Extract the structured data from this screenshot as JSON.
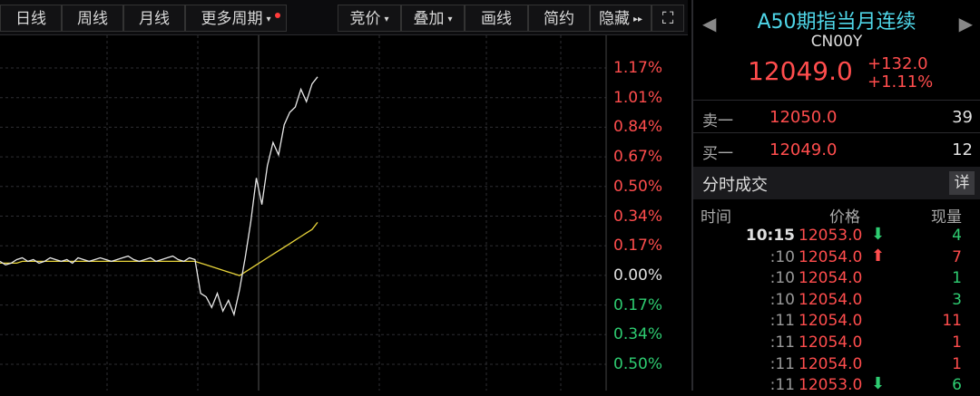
{
  "toolbar": {
    "items": [
      {
        "label": "日线",
        "arrow": ""
      },
      {
        "label": "周线",
        "arrow": ""
      },
      {
        "label": "月线",
        "arrow": ""
      },
      {
        "label": "更多周期",
        "arrow": "▾"
      },
      {
        "label": "竞价",
        "arrow": "▾"
      },
      {
        "label": "叠加",
        "arrow": "▾"
      },
      {
        "label": "画线",
        "arrow": ""
      },
      {
        "label": "简约",
        "arrow": ""
      },
      {
        "label": "隐藏",
        "arrow": "▸▸"
      }
    ],
    "expand_icon": "⛶",
    "colors": {
      "dot": "#ff3b3b"
    }
  },
  "chart_data": {
    "type": "line",
    "y_tick_labels": [
      "1.17%",
      "1.01%",
      "0.84%",
      "0.67%",
      "0.50%",
      "0.34%",
      "0.17%",
      "0.00%",
      "0.17%",
      "0.34%",
      "0.50%"
    ],
    "y_tick_colors": [
      "#ff4d4d",
      "#ff4d4d",
      "#ff4d4d",
      "#ff4d4d",
      "#ff4d4d",
      "#ff4d4d",
      "#ff4d4d",
      "#e0e0e0",
      "#2ecc71",
      "#2ecc71",
      "#2ecc71"
    ],
    "ylim": [
      -0.5,
      1.17
    ],
    "price_pct": [
      0.08,
      0.06,
      0.07,
      0.09,
      0.1,
      0.08,
      0.09,
      0.07,
      0.08,
      0.1,
      0.09,
      0.08,
      0.09,
      0.07,
      0.1,
      0.09,
      0.08,
      0.09,
      0.1,
      0.09,
      0.08,
      0.09,
      0.1,
      0.11,
      0.09,
      0.08,
      0.09,
      0.1,
      0.08,
      0.09,
      0.1,
      0.11,
      0.09,
      0.08,
      0.1,
      0.09,
      -0.1,
      -0.12,
      -0.18,
      -0.1,
      -0.2,
      -0.14,
      -0.22,
      -0.08,
      0.1,
      0.3,
      0.55,
      0.4,
      0.62,
      0.75,
      0.68,
      0.85,
      0.92,
      0.95,
      1.05,
      0.98,
      1.08,
      1.12
    ],
    "avg_pct": [
      0.07,
      0.07,
      0.07,
      0.07,
      0.08,
      0.08,
      0.08,
      0.08,
      0.08,
      0.08,
      0.08,
      0.08,
      0.08,
      0.08,
      0.08,
      0.08,
      0.08,
      0.08,
      0.08,
      0.08,
      0.08,
      0.08,
      0.08,
      0.08,
      0.08,
      0.08,
      0.08,
      0.08,
      0.08,
      0.08,
      0.08,
      0.08,
      0.08,
      0.08,
      0.08,
      0.08,
      0.07,
      0.06,
      0.05,
      0.04,
      0.03,
      0.02,
      0.01,
      0.0,
      0.02,
      0.04,
      0.06,
      0.08,
      0.1,
      0.12,
      0.14,
      0.16,
      0.18,
      0.2,
      0.22,
      0.24,
      0.26,
      0.3
    ],
    "colors": {
      "price": "#e8e8e8",
      "avg": "#e8d43a",
      "grid": "#2e2e32",
      "split": "#555"
    }
  },
  "quote": {
    "title": "A50期指当月连续",
    "code": "CN00Y",
    "price": "12049.0",
    "change": "+132.0",
    "change_pct": "+1.11%",
    "prev_arrow": "◀",
    "next_arrow": "▶"
  },
  "orderbook": [
    {
      "label": "卖一",
      "price": "12050.0",
      "volume": "39"
    },
    {
      "label": "买一",
      "price": "12049.0",
      "volume": "12"
    }
  ],
  "ticks": {
    "section_title": "分时成交",
    "detail_label": "详",
    "headers": {
      "time": "时间",
      "price": "价格",
      "volume": "现量"
    },
    "rows": [
      {
        "time": "10:15",
        "price": "12053.0",
        "dir": "⬇",
        "dir_color": "#2ecc71",
        "volume": "4",
        "vol_color": "#2ecc71",
        "time_color": "#e0e0e0"
      },
      {
        "time": ":10",
        "price": "12054.0",
        "dir": "⬆",
        "dir_color": "#ff4d4d",
        "volume": "7",
        "vol_color": "#ff4d4d",
        "time_color": "#999"
      },
      {
        "time": ":10",
        "price": "12054.0",
        "dir": "",
        "dir_color": "#ff4d4d",
        "volume": "1",
        "vol_color": "#2ecc71",
        "time_color": "#999"
      },
      {
        "time": ":10",
        "price": "12054.0",
        "dir": "",
        "dir_color": "#ff4d4d",
        "volume": "3",
        "vol_color": "#2ecc71",
        "time_color": "#999"
      },
      {
        "time": ":11",
        "price": "12054.0",
        "dir": "",
        "dir_color": "#ff4d4d",
        "volume": "11",
        "vol_color": "#ff4d4d",
        "time_color": "#999"
      },
      {
        "time": ":11",
        "price": "12054.0",
        "dir": "",
        "dir_color": "#ff4d4d",
        "volume": "1",
        "vol_color": "#ff4d4d",
        "time_color": "#999"
      },
      {
        "time": ":11",
        "price": "12054.0",
        "dir": "",
        "dir_color": "#ff4d4d",
        "volume": "1",
        "vol_color": "#ff4d4d",
        "time_color": "#999"
      },
      {
        "time": ":11",
        "price": "12053.0",
        "dir": "⬇",
        "dir_color": "#2ecc71",
        "volume": "6",
        "vol_color": "#2ecc71",
        "time_color": "#999"
      }
    ]
  }
}
